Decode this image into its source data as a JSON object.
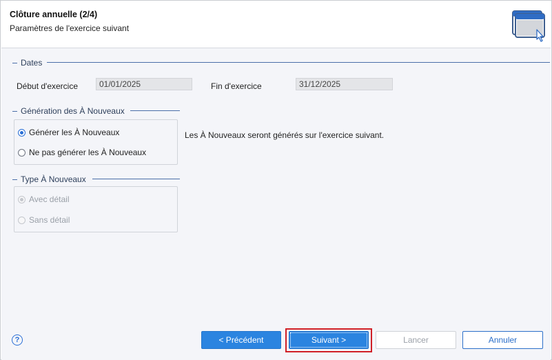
{
  "header": {
    "title": "Clôture annuelle (2/4)",
    "subtitle": "Paramètres de l'exercice suivant"
  },
  "dates": {
    "group_title": "Dates",
    "start_label": "Début d'exercice",
    "start_value": "01/01/2025",
    "end_label": "Fin d'exercice",
    "end_value": "31/12/2025"
  },
  "generation": {
    "group_title": "Génération des À Nouveaux",
    "options": [
      {
        "label": "Générer les À Nouveaux",
        "checked": true
      },
      {
        "label": "Ne pas générer les À Nouveaux",
        "checked": false
      }
    ],
    "info": "Les À Nouveaux seront générés sur l'exercice suivant."
  },
  "type": {
    "group_title": "Type À Nouveaux",
    "options": [
      {
        "label": "Avec détail",
        "checked": true,
        "disabled": true
      },
      {
        "label": "Sans détail",
        "checked": false,
        "disabled": true
      }
    ]
  },
  "footer": {
    "help": "?",
    "previous_label": "< Précédent",
    "next_label": "Suivant >",
    "cancel_label": "Lancer",
    "abort_label": "Annuler"
  },
  "colors": {
    "primary": "#2b84e0",
    "accent_line": "#4a6ea8",
    "focus_highlight": "#d01f26"
  }
}
